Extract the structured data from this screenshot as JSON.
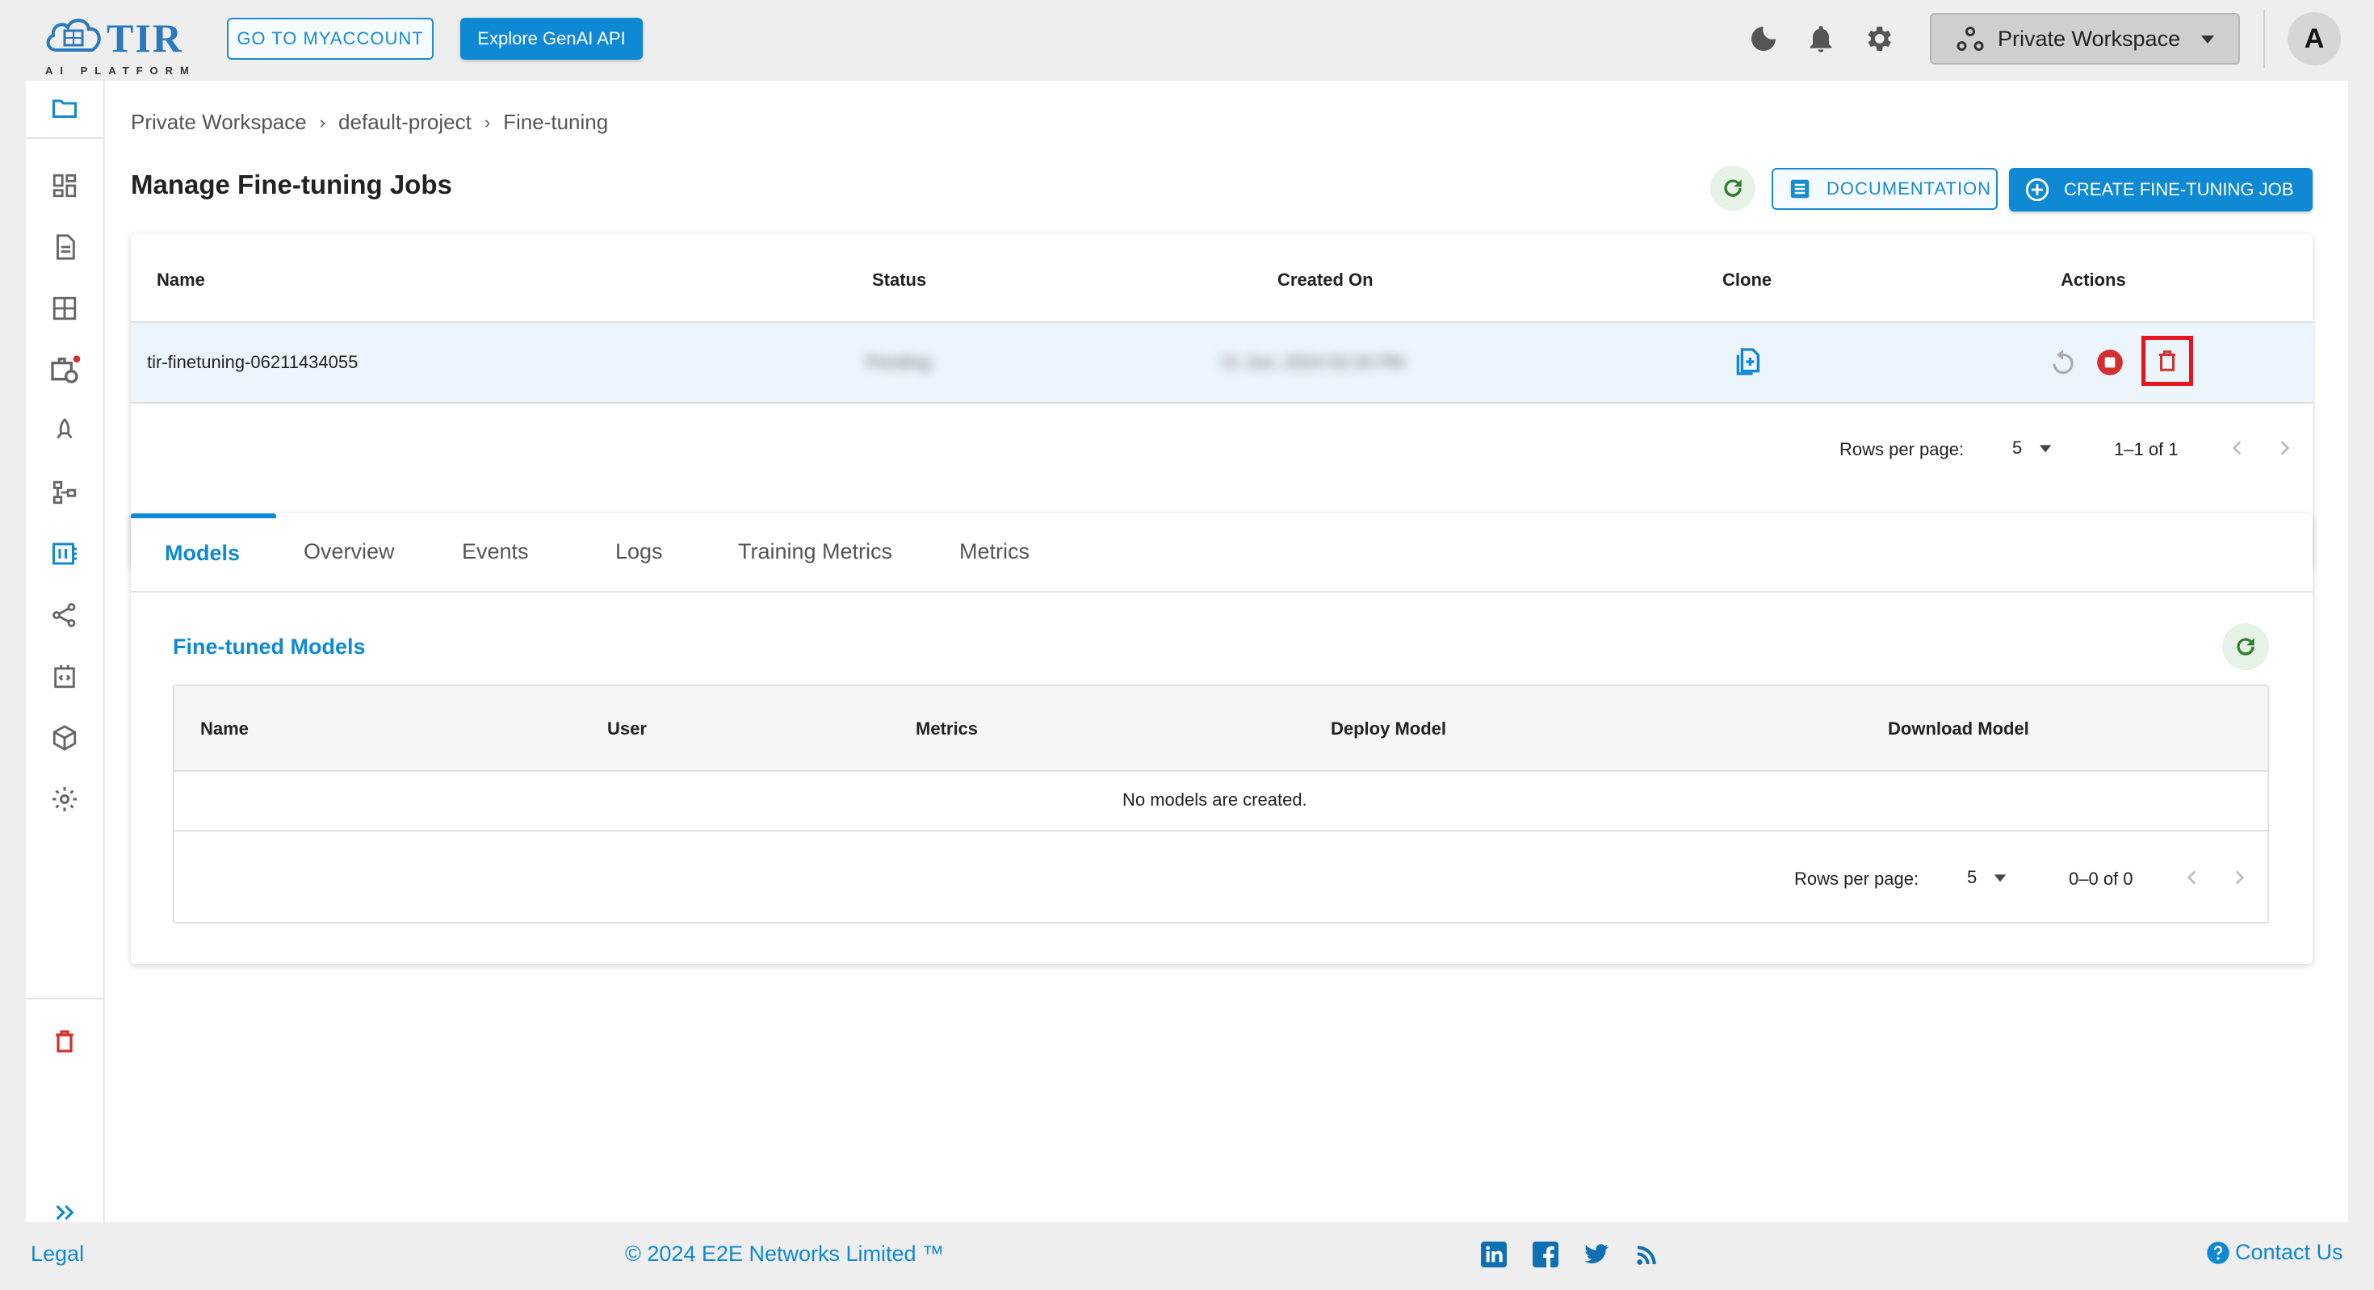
{
  "header": {
    "logo_text": "TIR",
    "logo_sub": "AI PLATFORM",
    "myaccount_button": "GO TO MYACCOUNT",
    "genai_button": "Explore GenAI API",
    "workspace_label": "Private Workspace",
    "avatar_initial": "A"
  },
  "breadcrumb": {
    "items": [
      "Private Workspace",
      "default-project",
      "Fine-tuning"
    ],
    "separator": "›"
  },
  "page": {
    "title": "Manage Fine-tuning Jobs",
    "documentation_button": "DOCUMENTATION",
    "create_button": "CREATE FINE-TUNING JOB"
  },
  "jobs_table": {
    "columns": [
      "Name",
      "Status",
      "Created On",
      "Clone",
      "Actions"
    ],
    "rows": [
      {
        "name": "tir-finetuning-06211434055",
        "status": "Pending",
        "created_on": "21 Jun, 2024 02:34 PM"
      }
    ],
    "rows_per_page_label": "Rows per page:",
    "rows_per_page_value": "5",
    "range": "1–1 of 1"
  },
  "tabs": {
    "items": [
      "Models",
      "Overview",
      "Events",
      "Logs",
      "Training Metrics",
      "Metrics"
    ],
    "active": "Models"
  },
  "models_section": {
    "title": "Fine-tuned Models",
    "columns": [
      "Name",
      "User",
      "Metrics",
      "Deploy Model",
      "Download Model"
    ],
    "empty_message": "No models are created.",
    "rows_per_page_label": "Rows per page:",
    "rows_per_page_value": "5",
    "range": "0–0 of 0"
  },
  "footer": {
    "legal": "Legal",
    "copyright": "© 2024 E2E Networks Limited ™",
    "contact": "Contact Us"
  },
  "colors": {
    "accent": "#0f89d4",
    "danger": "#d32f2f",
    "highlight_box": "#e8131b",
    "refresh_green": "#2e7d32",
    "row_selected": "#edf5fc"
  }
}
